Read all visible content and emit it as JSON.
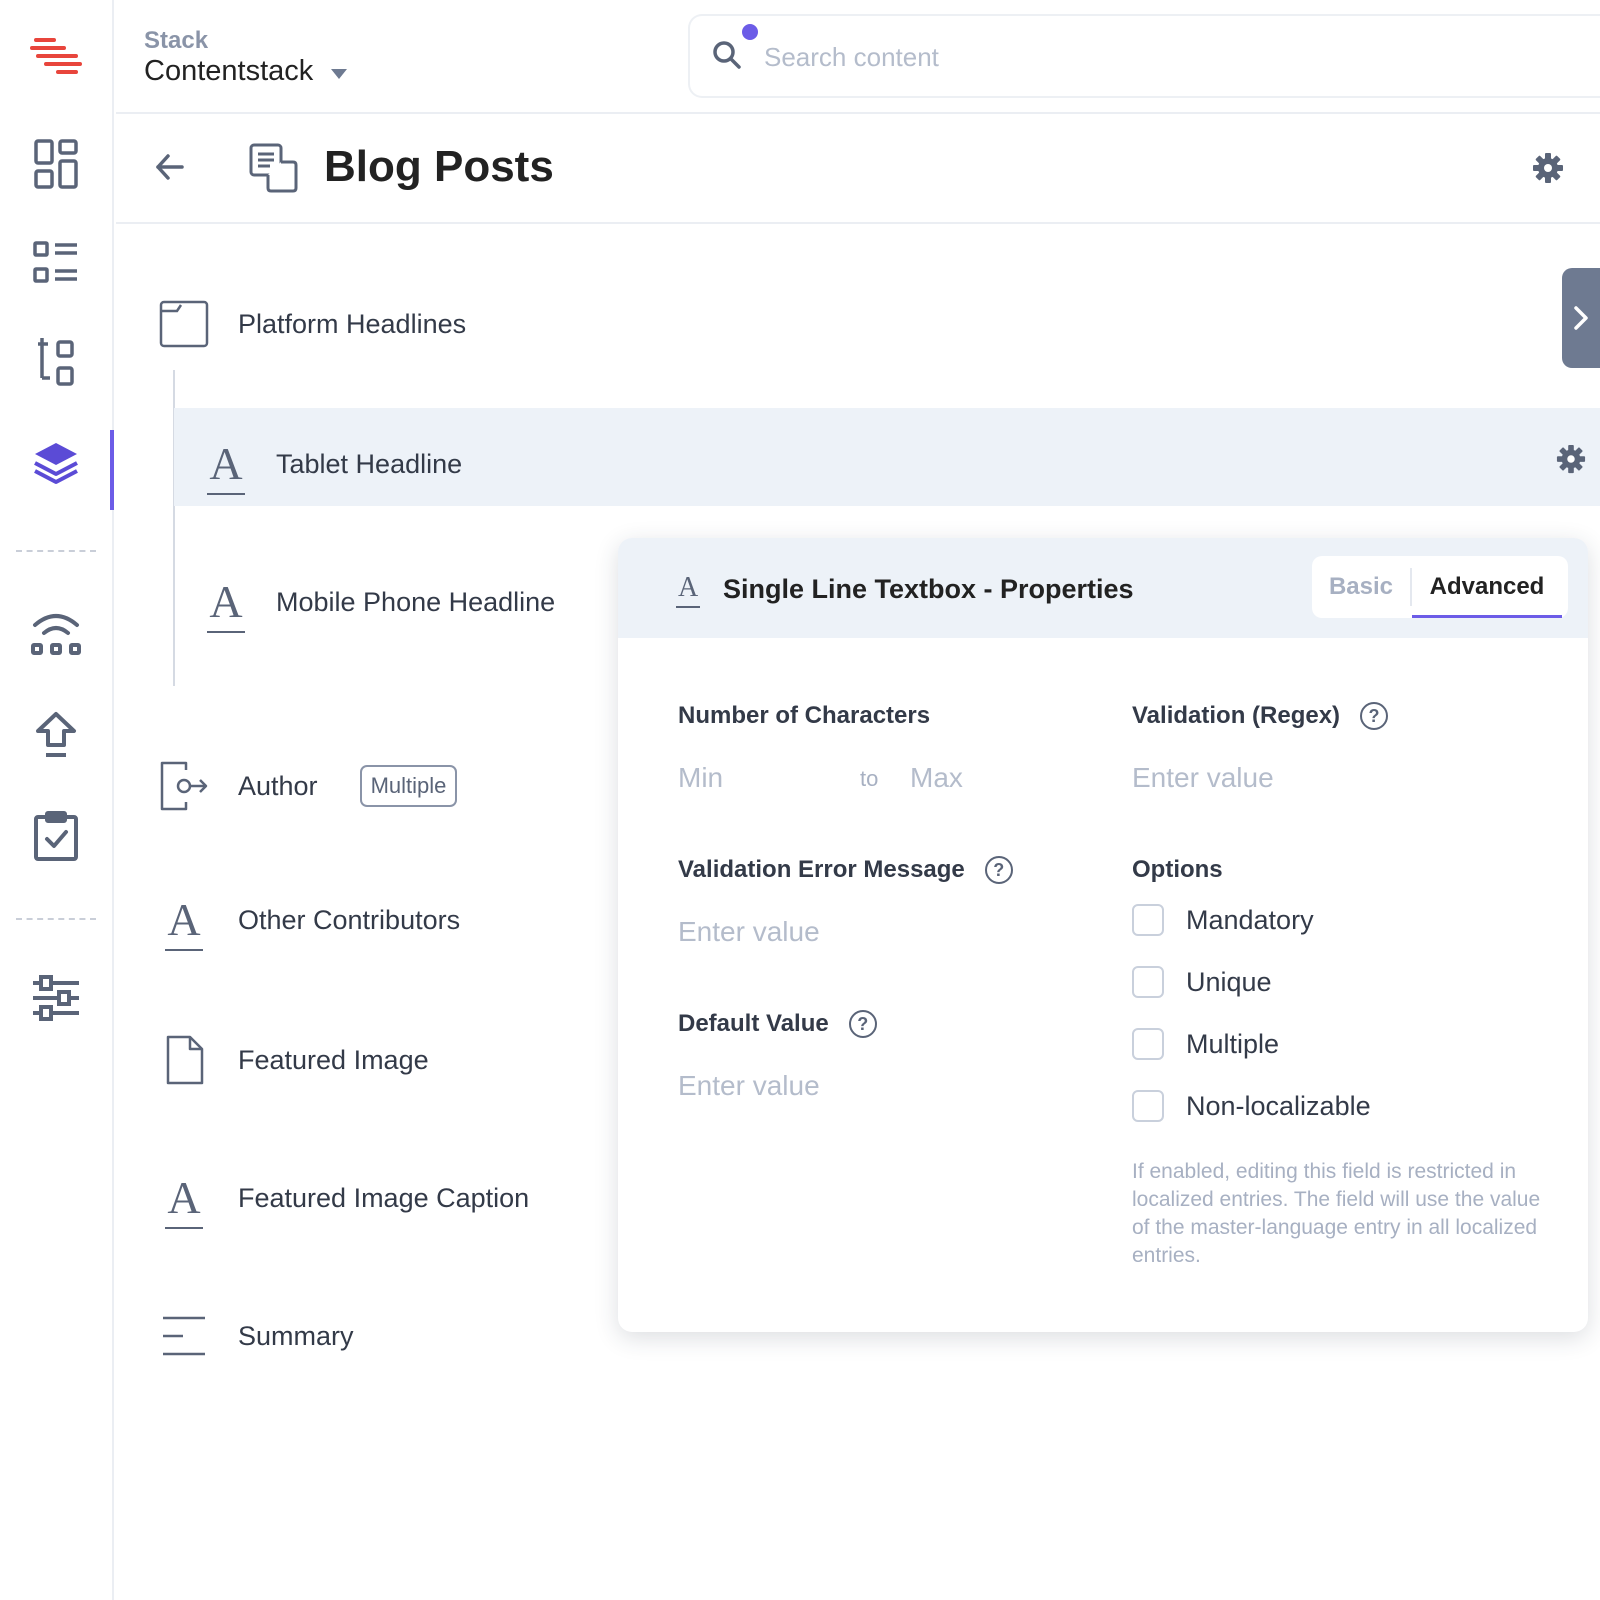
{
  "header": {
    "stack_label": "Stack",
    "stack_name": "Contentstack",
    "search_placeholder": "Search content"
  },
  "page": {
    "title": "Blog Posts"
  },
  "fields": [
    {
      "label": "Platform Headlines",
      "icon": "group-folder-icon"
    },
    {
      "label": "Tablet Headline",
      "icon": "single-line-text-icon",
      "selected": true
    },
    {
      "label": "Mobile Phone Headline",
      "icon": "single-line-text-icon"
    },
    {
      "label": "Author",
      "icon": "reference-icon",
      "badge": "Multiple"
    },
    {
      "label": "Other Contributors",
      "icon": "single-line-text-icon"
    },
    {
      "label": "Featured Image",
      "icon": "file-icon"
    },
    {
      "label": "Featured Image Caption",
      "icon": "single-line-text-icon"
    },
    {
      "label": "Summary",
      "icon": "multi-line-text-icon"
    }
  ],
  "panel": {
    "title": "Single Line Textbox - Properties",
    "tabs": {
      "basic": "Basic",
      "advanced": "Advanced",
      "active": "Advanced"
    },
    "num_chars": {
      "label": "Number of Characters",
      "min_placeholder": "Min",
      "to": "to",
      "max_placeholder": "Max"
    },
    "regex": {
      "label": "Validation (Regex)",
      "placeholder": "Enter value"
    },
    "error_msg": {
      "label": "Validation Error Message",
      "placeholder": "Enter value"
    },
    "default_value": {
      "label": "Default Value",
      "placeholder": "Enter value"
    },
    "options": {
      "label": "Options",
      "items": [
        {
          "label": "Mandatory",
          "checked": false
        },
        {
          "label": "Unique",
          "checked": false
        },
        {
          "label": "Multiple",
          "checked": false
        },
        {
          "label": "Non-localizable",
          "checked": false
        }
      ],
      "hint": "If enabled, editing this field is restricted in localized entries. The field will use the value of the master-language entry in all localized entries."
    }
  },
  "colors": {
    "accent": "#6c5ce7",
    "brand_red": "#e8453c",
    "icon_slate": "#5a6478",
    "selected_bg": "#edf2f8"
  }
}
